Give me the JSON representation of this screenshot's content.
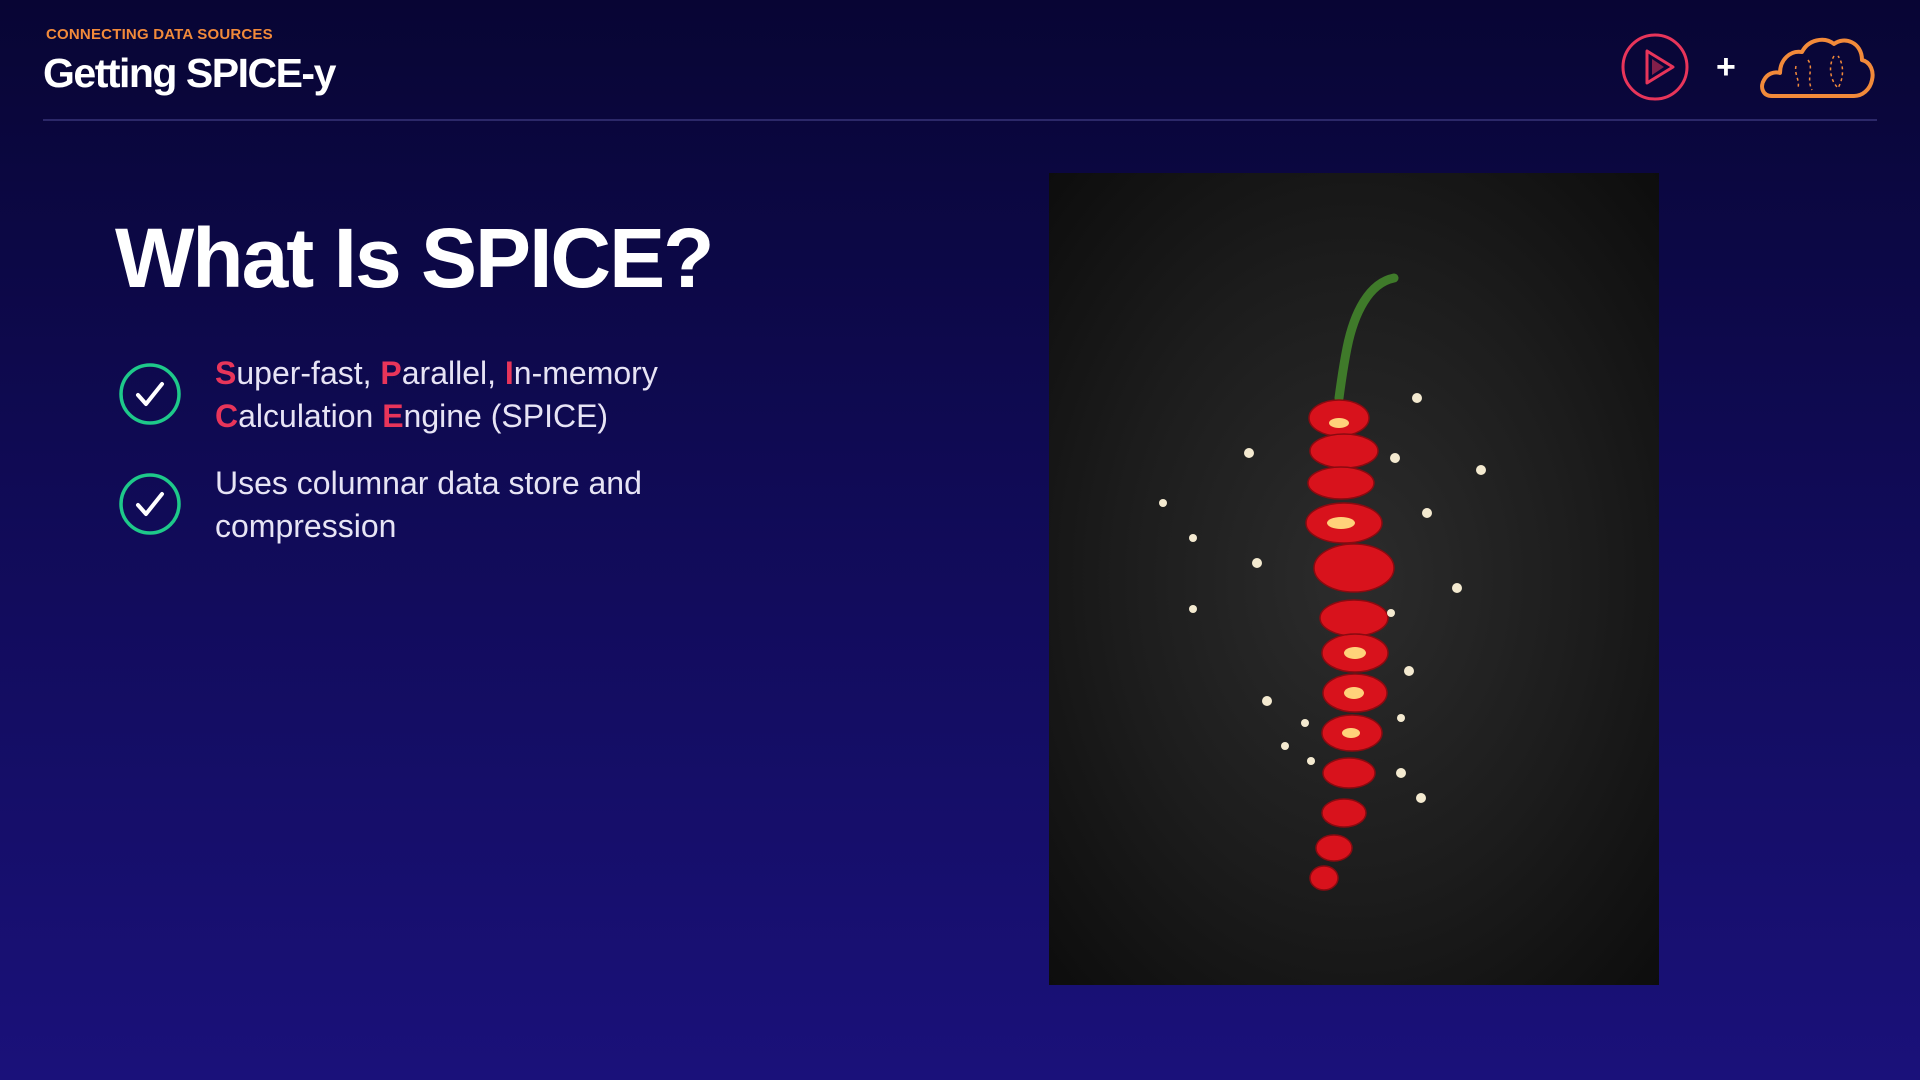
{
  "header": {
    "eyebrow": "CONNECTING DATA SOURCES",
    "title": "Getting SPICE-y",
    "plus": "+"
  },
  "slide": {
    "title": "What Is SPICE?",
    "bullets": [
      {
        "line1": [
          {
            "t": "S",
            "hl": true
          },
          {
            "t": "uper-fast, ",
            "hl": false
          },
          {
            "t": "P",
            "hl": true
          },
          {
            "t": "arallel, ",
            "hl": false
          },
          {
            "t": "I",
            "hl": true
          },
          {
            "t": "n-memory",
            "hl": false
          }
        ],
        "line2": [
          {
            "t": "C",
            "hl": true
          },
          {
            "t": "alculation ",
            "hl": false
          },
          {
            "t": "E",
            "hl": true
          },
          {
            "t": "ngine (SPICE)",
            "hl": false
          }
        ]
      },
      {
        "line1": [
          {
            "t": "Uses columnar data store and",
            "hl": false
          }
        ],
        "line2": [
          {
            "t": "compression",
            "hl": false
          }
        ]
      }
    ]
  },
  "icons": {
    "check": "check-circle-icon",
    "play_logo": "play-logo-icon",
    "cloud_logo": "cloud-logo-icon"
  },
  "colors": {
    "accent_orange": "#f28a3a",
    "highlight_red": "#e8355a",
    "check_green": "#1ec98a",
    "play_logo_pink": "#e8355a"
  },
  "image": {
    "subject": "sliced red chili pepper on dark background"
  }
}
